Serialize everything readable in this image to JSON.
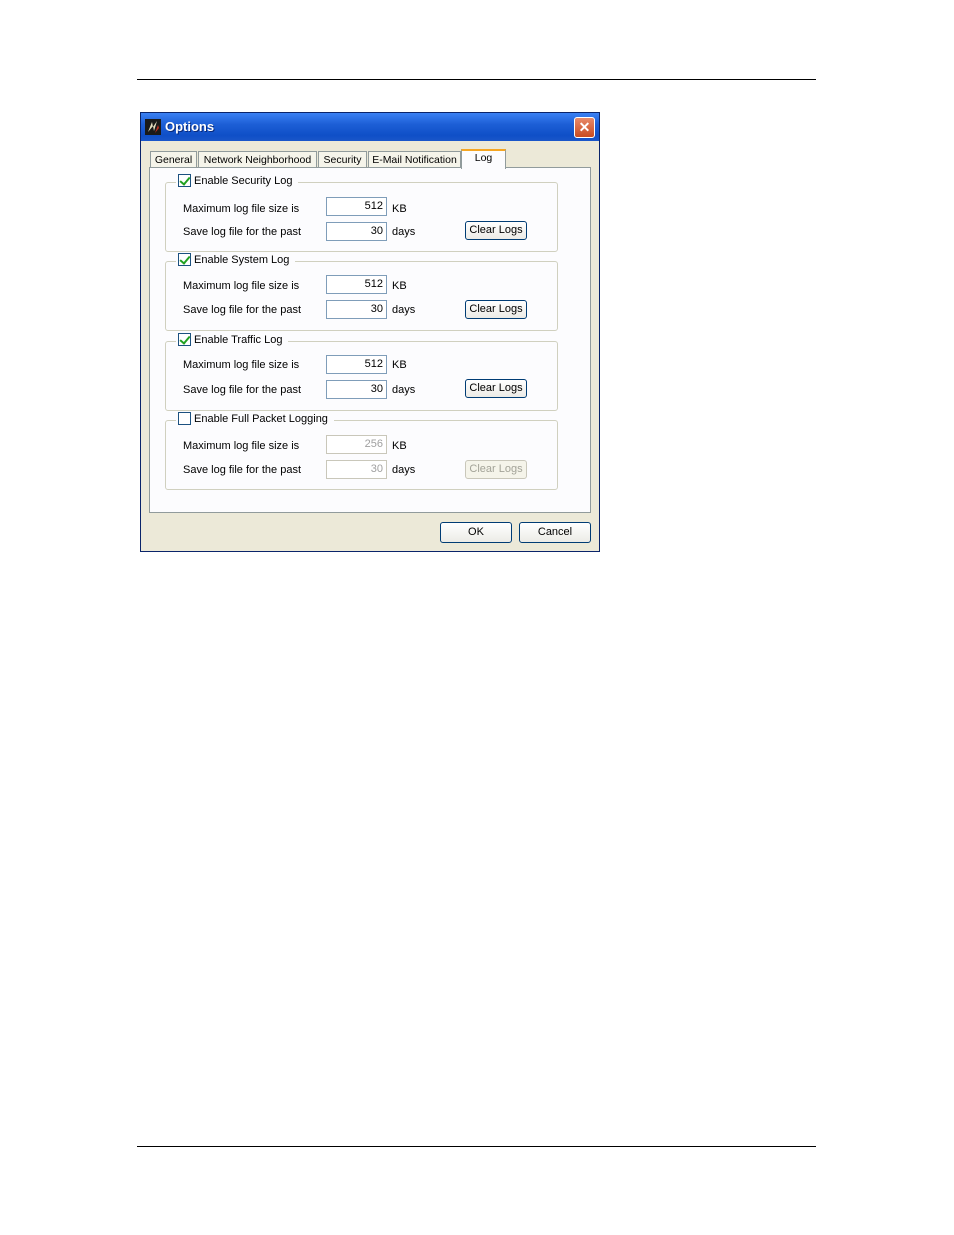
{
  "window": {
    "title": "Options",
    "tabs": [
      {
        "label": "General"
      },
      {
        "label": "Network Neighborhood"
      },
      {
        "label": "Security"
      },
      {
        "label": "E-Mail Notification"
      },
      {
        "label": "Log",
        "active": true
      }
    ],
    "groups": [
      {
        "label": "Enable Security Log",
        "checked": true,
        "size_label": "Maximum log file size is",
        "size_value": "512",
        "size_unit": "KB",
        "days_label": "Save log file for the past",
        "days_value": "30",
        "days_unit": "days",
        "button": "Clear Logs",
        "enabled": true
      },
      {
        "label": "Enable System Log",
        "checked": true,
        "size_label": "Maximum log file size is",
        "size_value": "512",
        "size_unit": "KB",
        "days_label": "Save log file for the past",
        "days_value": "30",
        "days_unit": "days",
        "button": "Clear Logs",
        "enabled": true
      },
      {
        "label": "Enable Traffic Log",
        "checked": true,
        "size_label": "Maximum log file size is",
        "size_value": "512",
        "size_unit": "KB",
        "days_label": "Save log file for the past",
        "days_value": "30",
        "days_unit": "days",
        "button": "Clear Logs",
        "enabled": true
      },
      {
        "label": "Enable Full Packet Logging",
        "checked": false,
        "size_label": "Maximum log file size is",
        "size_value": "256",
        "size_unit": "KB",
        "days_label": "Save log file for the past",
        "days_value": "30",
        "days_unit": "days",
        "button": "Clear Logs",
        "enabled": false
      }
    ],
    "ok_label": "OK",
    "cancel_label": "Cancel",
    "icons": {
      "app": "firewall-app-icon",
      "close": "close-icon"
    },
    "colors": {
      "titlebar": "#0f4fc7",
      "tab_highlight": "#f5a623",
      "checkmark": "#21a121"
    }
  }
}
